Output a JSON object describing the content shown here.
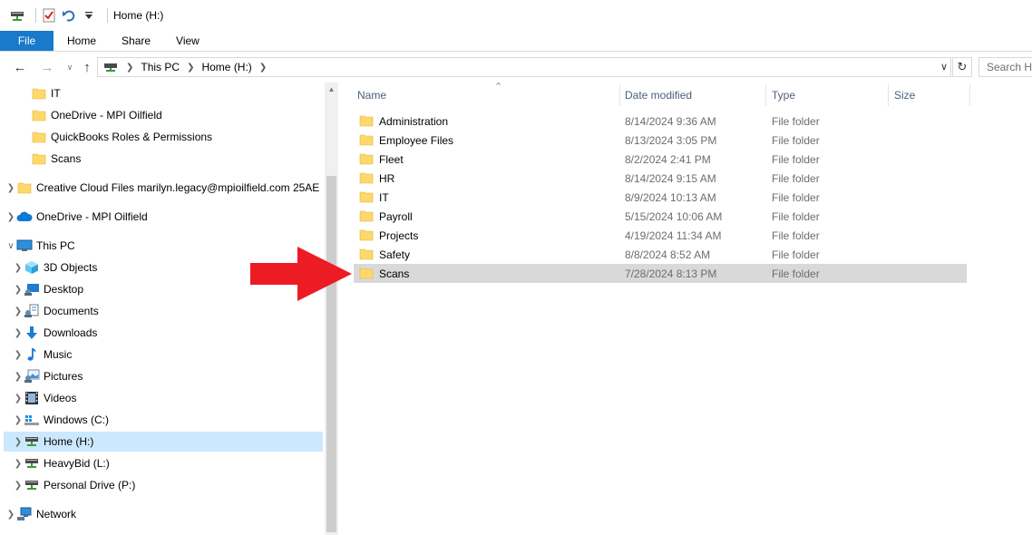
{
  "titlebar": {
    "title": "Home (H:)",
    "icons": [
      "drive-icon",
      "properties-check-icon",
      "undo-icon",
      "customize-quick-access-icon"
    ]
  },
  "ribbon": {
    "tabs": [
      "File",
      "Home",
      "Share",
      "View"
    ]
  },
  "address": {
    "breadcrumbs": [
      "This PC",
      "Home (H:)"
    ],
    "search_placeholder": "Search Home (H:)",
    "search_visible": "Search Ho"
  },
  "nav": {
    "items": [
      {
        "label": "IT",
        "icon": "folder-icon"
      },
      {
        "label": "OneDrive - MPI Oilfield",
        "icon": "folder-icon"
      },
      {
        "label": "QuickBooks Roles & Permissions",
        "icon": "folder-icon"
      },
      {
        "label": "Scans",
        "icon": "folder-icon"
      },
      {
        "label": "Creative Cloud Files  marilyn.legacy@mpioilfield.com 25AE",
        "icon": "folder-icon"
      },
      {
        "label": "OneDrive - MPI Oilfield",
        "icon": "cloud-icon"
      },
      {
        "label": "This PC",
        "icon": "computer-icon"
      },
      {
        "label": "3D Objects",
        "icon": "cube-icon"
      },
      {
        "label": "Desktop",
        "icon": "desktop-icon"
      },
      {
        "label": "Documents",
        "icon": "documents-icon"
      },
      {
        "label": "Downloads",
        "icon": "download-icon"
      },
      {
        "label": "Music",
        "icon": "music-icon"
      },
      {
        "label": "Pictures",
        "icon": "pictures-icon"
      },
      {
        "label": "Videos",
        "icon": "videos-icon"
      },
      {
        "label": "Windows  (C:)",
        "icon": "windows-drive-icon"
      },
      {
        "label": "Home (H:)",
        "icon": "network-drive-icon"
      },
      {
        "label": "HeavyBid (L:)",
        "icon": "network-drive-icon"
      },
      {
        "label": "Personal Drive (P:)",
        "icon": "network-drive-icon"
      },
      {
        "label": "Network",
        "icon": "network-icon"
      }
    ],
    "selected": "Home (H:)"
  },
  "columns": {
    "name": "Name",
    "date": "Date modified",
    "type": "Type",
    "size": "Size"
  },
  "files": [
    {
      "name": "Administration",
      "date": "8/14/2024 9:36 AM",
      "type": "File folder"
    },
    {
      "name": "Employee Files",
      "date": "8/13/2024 3:05 PM",
      "type": "File folder"
    },
    {
      "name": "Fleet",
      "date": "8/2/2024 2:41 PM",
      "type": "File folder"
    },
    {
      "name": "HR",
      "date": "8/14/2024 9:15 AM",
      "type": "File folder"
    },
    {
      "name": "IT",
      "date": "8/9/2024 10:13 AM",
      "type": "File folder"
    },
    {
      "name": "Payroll",
      "date": "5/15/2024 10:06 AM",
      "type": "File folder"
    },
    {
      "name": "Projects",
      "date": "4/19/2024 11:34 AM",
      "type": "File folder"
    },
    {
      "name": "Safety",
      "date": "8/8/2024 8:52 AM",
      "type": "File folder"
    },
    {
      "name": "Scans",
      "date": "7/28/2024 8:13 PM",
      "type": "File folder"
    }
  ],
  "selected_file": "Scans",
  "colors": {
    "file_tab": "#1979ca",
    "selection_nav": "#cce8ff",
    "selection_row": "#d9d9d9",
    "folder": "#ffd86b",
    "annotation_arrow": "#ed1c24"
  }
}
